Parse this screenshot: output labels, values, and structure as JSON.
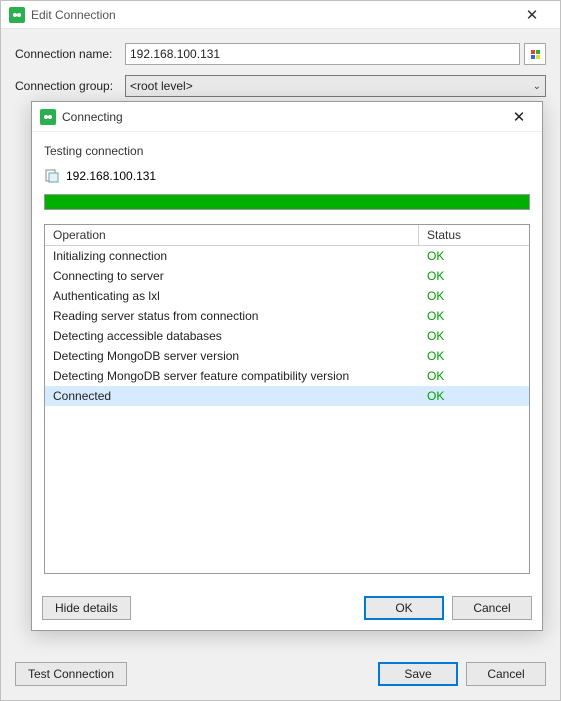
{
  "outer": {
    "title": "Edit Connection",
    "name_label": "Connection name:",
    "name_value": "192.168.100.131",
    "group_label": "Connection group:",
    "group_value": "<root level>",
    "test_btn": "Test Connection",
    "save_btn": "Save",
    "cancel_btn": "Cancel"
  },
  "modal": {
    "title": "Connecting",
    "testing_label": "Testing connection",
    "server": "192.168.100.131",
    "columns": {
      "operation": "Operation",
      "status": "Status"
    },
    "rows": [
      {
        "op": "Initializing connection",
        "status": "OK",
        "sel": false
      },
      {
        "op": "Connecting to server",
        "status": "OK",
        "sel": false
      },
      {
        "op": "Authenticating as lxl",
        "status": "OK",
        "sel": false
      },
      {
        "op": "Reading server status from connection",
        "status": "OK",
        "sel": false
      },
      {
        "op": "Detecting accessible databases",
        "status": "OK",
        "sel": false
      },
      {
        "op": "Detecting MongoDB server version",
        "status": "OK",
        "sel": false
      },
      {
        "op": "Detecting MongoDB server feature compatibility version",
        "status": "OK",
        "sel": false
      },
      {
        "op": "Connected",
        "status": "OK",
        "sel": true
      }
    ],
    "hide_btn": "Hide details",
    "ok_btn": "OK",
    "cancel_btn": "Cancel"
  },
  "colors": {
    "ok": "#00a000",
    "progress": "#00b000",
    "selection": "#d6ebff",
    "primary_border": "#0078d7"
  }
}
